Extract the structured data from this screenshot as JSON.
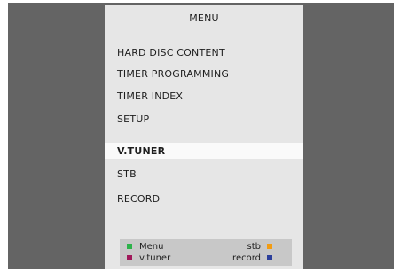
{
  "menu": {
    "title": "MENU",
    "items": [
      {
        "label": "HARD DISC CONTENT"
      },
      {
        "label": "TIMER PROGRAMMING"
      },
      {
        "label": "TIMER INDEX"
      },
      {
        "label": "SETUP"
      },
      {
        "label": "V.TUNER",
        "selected": true
      },
      {
        "label": "STB"
      },
      {
        "label": "RECORD"
      }
    ]
  },
  "legend": {
    "left": [
      {
        "label": "Menu",
        "color": "#2db24a"
      },
      {
        "label": "v.tuner",
        "color": "#a0185a"
      }
    ],
    "right": [
      {
        "label": "stb",
        "color": "#f39c12"
      },
      {
        "label": "record",
        "color": "#2c3f9b"
      }
    ]
  },
  "colors": {
    "background": "#646464",
    "panel": "#e6e6e6",
    "highlight": "#fafafa",
    "legend_bg": "#c8c8c8"
  }
}
